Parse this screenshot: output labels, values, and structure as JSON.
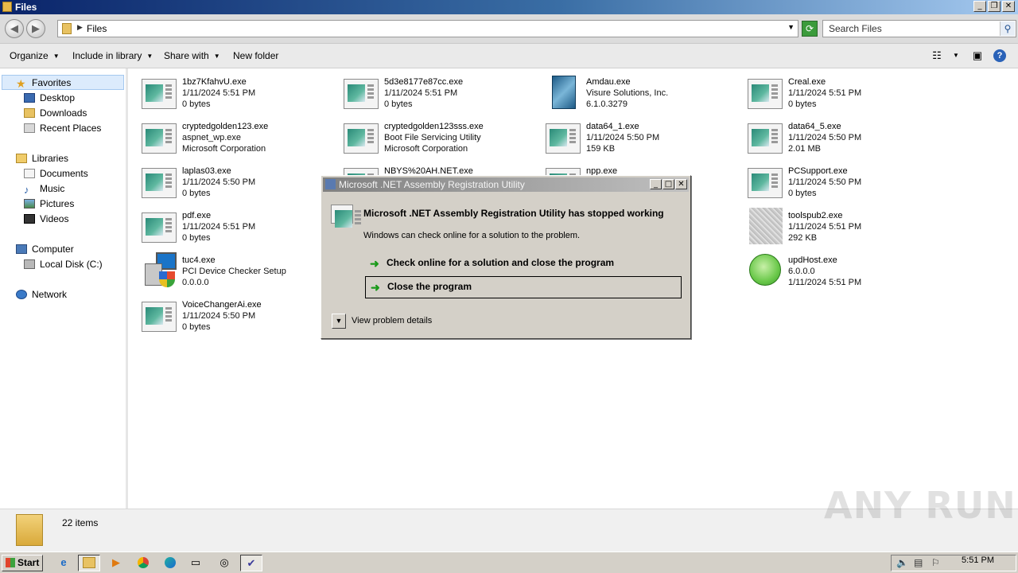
{
  "window": {
    "title": "Files"
  },
  "address": {
    "path": "Files",
    "search_placeholder": "Search Files"
  },
  "toolbar": {
    "organize": "Organize",
    "include": "Include in library",
    "share": "Share with",
    "new_folder": "New folder"
  },
  "nav": {
    "favorites": "Favorites",
    "desktop": "Desktop",
    "downloads": "Downloads",
    "recent": "Recent Places",
    "libraries": "Libraries",
    "documents": "Documents",
    "music": "Music",
    "pictures": "Pictures",
    "videos": "Videos",
    "computer": "Computer",
    "localdisk": "Local Disk (C:)",
    "network": "Network"
  },
  "files": [
    {
      "name": "1bz7KfahvU.exe",
      "l2": "1/11/2024 5:51 PM",
      "l3": "0 bytes",
      "icon": "exe-icon"
    },
    {
      "name": "5d3e8177e87cc.exe",
      "l2": "1/11/2024 5:51 PM",
      "l3": "0 bytes",
      "icon": "exe-icon"
    },
    {
      "name": "Amdau.exe",
      "l2": "Visure Solutions, Inc.",
      "l3": "6.1.0.3279",
      "icon": "amdau-icon"
    },
    {
      "name": "Creal.exe",
      "l2": "1/11/2024 5:51 PM",
      "l3": "0 bytes",
      "icon": "exe-icon"
    },
    {
      "name": "cryptedgolden123.exe",
      "l2": "aspnet_wp.exe",
      "l3": "Microsoft Corporation",
      "icon": "exe-icon"
    },
    {
      "name": "cryptedgolden123sss.exe",
      "l2": "Boot File Servicing Utility",
      "l3": "Microsoft Corporation",
      "icon": "exe-icon"
    },
    {
      "name": "data64_1.exe",
      "l2": "1/11/2024 5:50 PM",
      "l3": "159 KB",
      "icon": "exe-icon"
    },
    {
      "name": "data64_5.exe",
      "l2": "1/11/2024 5:50 PM",
      "l3": "2.01 MB",
      "icon": "exe-icon"
    },
    {
      "name": "laplas03.exe",
      "l2": "1/11/2024 5:50 PM",
      "l3": "0 bytes",
      "icon": "exe-icon"
    },
    {
      "name": "NBYS%20AH.NET.exe",
      "l2": "",
      "l3": "",
      "icon": "exe-icon"
    },
    {
      "name": "npp.exe",
      "l2": "",
      "l3": "",
      "icon": "exe-icon"
    },
    {
      "name": "PCSupport.exe",
      "l2": "1/11/2024 5:50 PM",
      "l3": "0 bytes",
      "icon": "exe-icon"
    },
    {
      "name": "pdf.exe",
      "l2": "1/11/2024 5:51 PM",
      "l3": "0 bytes",
      "icon": "exe-icon"
    },
    {
      "name": "toolspub2.exe",
      "l2": "1/11/2024 5:51 PM",
      "l3": "292 KB",
      "icon": "noise-icon"
    },
    {
      "name": "tuc4.exe",
      "l2": "PCI Device Checker Setup",
      "l3": "0.0.0.0",
      "icon": "installer-icon"
    },
    {
      "name": "updHost.exe",
      "l2": "6.0.0.0",
      "l3": "1/11/2024 5:51 PM",
      "icon": "green-circle-icon"
    },
    {
      "name": "VoiceChangerAi.exe",
      "l2": "1/11/2024 5:50 PM",
      "l3": "0 bytes",
      "icon": "exe-icon"
    }
  ],
  "status": {
    "count": "22 items"
  },
  "dialog": {
    "title": "Microsoft .NET Assembly Registration Utility",
    "heading": "Microsoft .NET Assembly Registration Utility has stopped working",
    "subtext": "Windows can check online for a solution to the problem.",
    "option1": "Check online for a solution and close the program",
    "option2": "Close the program",
    "details": "View problem details"
  },
  "taskbar": {
    "start": "Start",
    "clock": "5:51 PM"
  },
  "watermark": "ANY RUN"
}
